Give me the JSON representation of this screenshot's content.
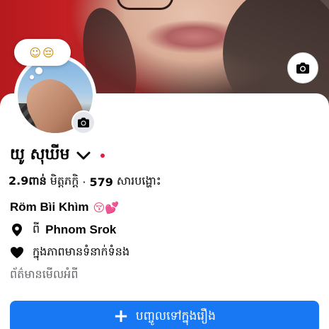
{
  "cover": {
    "camera_icon": "camera-icon"
  },
  "profile": {
    "note_emoji": "☺😔",
    "avatar_camera_icon": "camera-icon",
    "name": "យូ សុឃីម",
    "name_chevron_icon": "chevron-down-icon",
    "status_dot_color": "#e41e3f"
  },
  "stats": {
    "friends_count": "2.9ពាន់",
    "friends_label": "មិត្តភក្តិ",
    "separator": "·",
    "posts_count": "579",
    "posts_label": "សារបង្ហោះ"
  },
  "bio": {
    "text": "Röm Bìi Khìm",
    "emoji": "😚💕"
  },
  "details": {
    "location_icon": "location-pin-icon",
    "location_prefix": "ពី",
    "location_name": "Phnom Srok",
    "relationship_icon": "heart-icon",
    "relationship_text": "ក្នុងភាពមានទំនាក់ទំនង",
    "see_about": "ព័ត៌មានមើលអំពី"
  },
  "actions": {
    "add_story_plus": "+",
    "add_story_label": "បញ្ចូលទៅក្នុងរឿង"
  },
  "colors": {
    "primary": "#1877f2",
    "text": "#050505",
    "muted": "#65676b",
    "status_dot": "#e41e3f"
  }
}
